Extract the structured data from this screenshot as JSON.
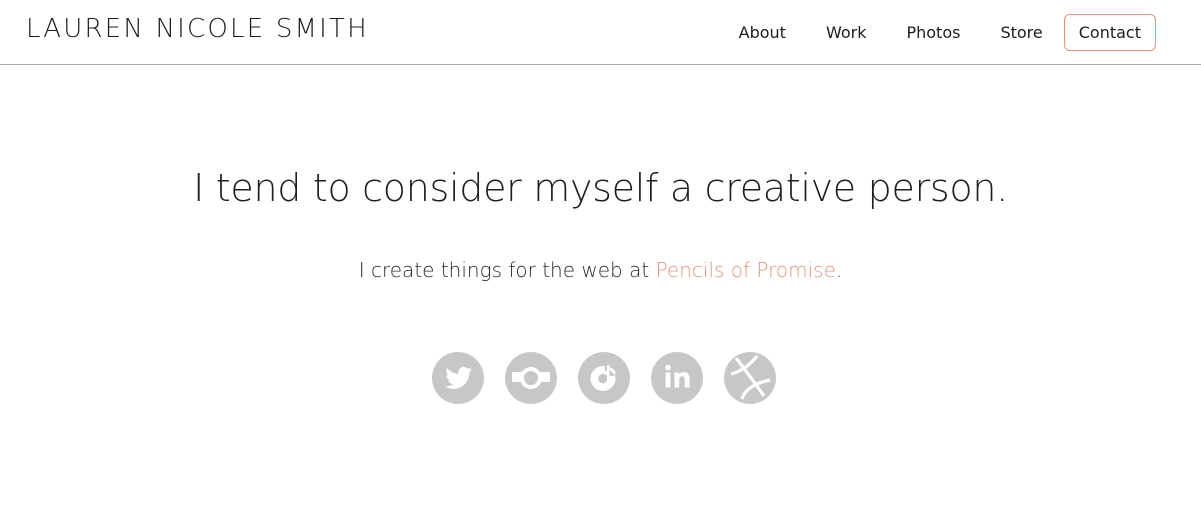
{
  "header": {
    "logo": "LAUREN NICOLE SMITH",
    "nav": [
      {
        "label": "About"
      },
      {
        "label": "Work"
      },
      {
        "label": "Photos"
      },
      {
        "label": "Store"
      }
    ],
    "contact_label": "Contact"
  },
  "hero": {
    "headline": "I tend to consider myself a creative person.",
    "sub_prefix": "I create things for the web at ",
    "sub_link": "Pencils of Promise",
    "sub_suffix": "."
  },
  "socials": [
    {
      "icon": "twitter-icon"
    },
    {
      "icon": "instagram-icon"
    },
    {
      "icon": "vine-icon"
    },
    {
      "icon": "linkedin-icon"
    },
    {
      "icon": "dribbble-icon"
    }
  ],
  "colors": {
    "accent": "#e3957a",
    "icon_gray": "#c8c6c6",
    "divider": "#a9a9a9"
  }
}
